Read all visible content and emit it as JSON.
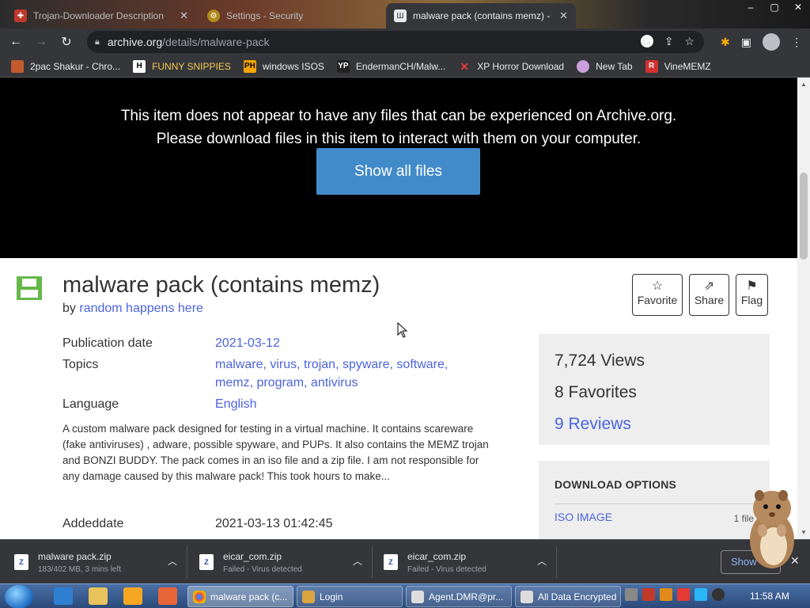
{
  "browser": {
    "tabs": [
      {
        "label": "Trojan-Downloader Description"
      },
      {
        "label": "Settings - Security"
      },
      {
        "label": "malware pack (contains memz) -"
      }
    ],
    "url_host": "archive.org",
    "url_path": "/details/malware-pack",
    "bookmarks": [
      {
        "label": "2pac Shakur - Chro..."
      },
      {
        "label": "FUNNY SNIPPIES"
      },
      {
        "label": "windows ISOS"
      },
      {
        "label": "EndermanCH/Malw..."
      },
      {
        "label": "XP Horror Download"
      },
      {
        "label": "New Tab"
      },
      {
        "label": "VineMEMZ"
      }
    ]
  },
  "notice": {
    "line1": "This item does not appear to have any files that can be experienced on Archive.org.",
    "line2": "Please download files in this item to interact with them on your computer.",
    "button": "Show all files"
  },
  "item": {
    "title": "malware pack (contains memz)",
    "by_prefix": "by",
    "author": "random happens here",
    "actions": {
      "favorite": "Favorite",
      "share": "Share",
      "flag": "Flag"
    },
    "meta": {
      "pub_label": "Publication date",
      "pub_value": "2021-03-12",
      "topics_label": "Topics",
      "topics": [
        "malware",
        "virus",
        "trojan",
        "spyware",
        "software",
        "memz",
        "program",
        "antivirus"
      ],
      "lang_label": "Language",
      "lang_value": "English"
    },
    "description": "A custom malware pack designed for testing in a virtual machine. It contains scareware (fake antiviruses) , adware, possible spyware, and PUPs. It also contains the MEMZ trojan and BONZI BUDDY. The pack comes in an iso file and a zip file. I am not responsible for any damage caused by this malware pack! This took hours to make...",
    "added_label": "Addeddate",
    "added_value": "2021-03-13 01:42:45",
    "stats": {
      "views": "7,724 Views",
      "favorites": "8 Favorites",
      "reviews": "9 Reviews"
    },
    "download_options": {
      "header": "DOWNLOAD OPTIONS",
      "first": "ISO IMAGE",
      "first_count": "1 file"
    }
  },
  "downloads": [
    {
      "name": "malware pack.zip",
      "status": "183/402 MB, 3 mins left"
    },
    {
      "name": "eicar_com.zip",
      "status": "Failed - Virus detected"
    },
    {
      "name": "eicar_com.zip",
      "status": "Failed - Virus detected"
    }
  ],
  "downloads_showall": "Show",
  "taskbar": {
    "buttons": [
      {
        "label": "malware pack (c..."
      },
      {
        "label": "Login"
      },
      {
        "label": "Agent.DMR@pr..."
      },
      {
        "label": "All Data Encrypted"
      }
    ],
    "clock": "11:58 AM"
  },
  "colors": {
    "accent": "#428bca",
    "link": "#4b64de",
    "chrome": "#35363a"
  }
}
